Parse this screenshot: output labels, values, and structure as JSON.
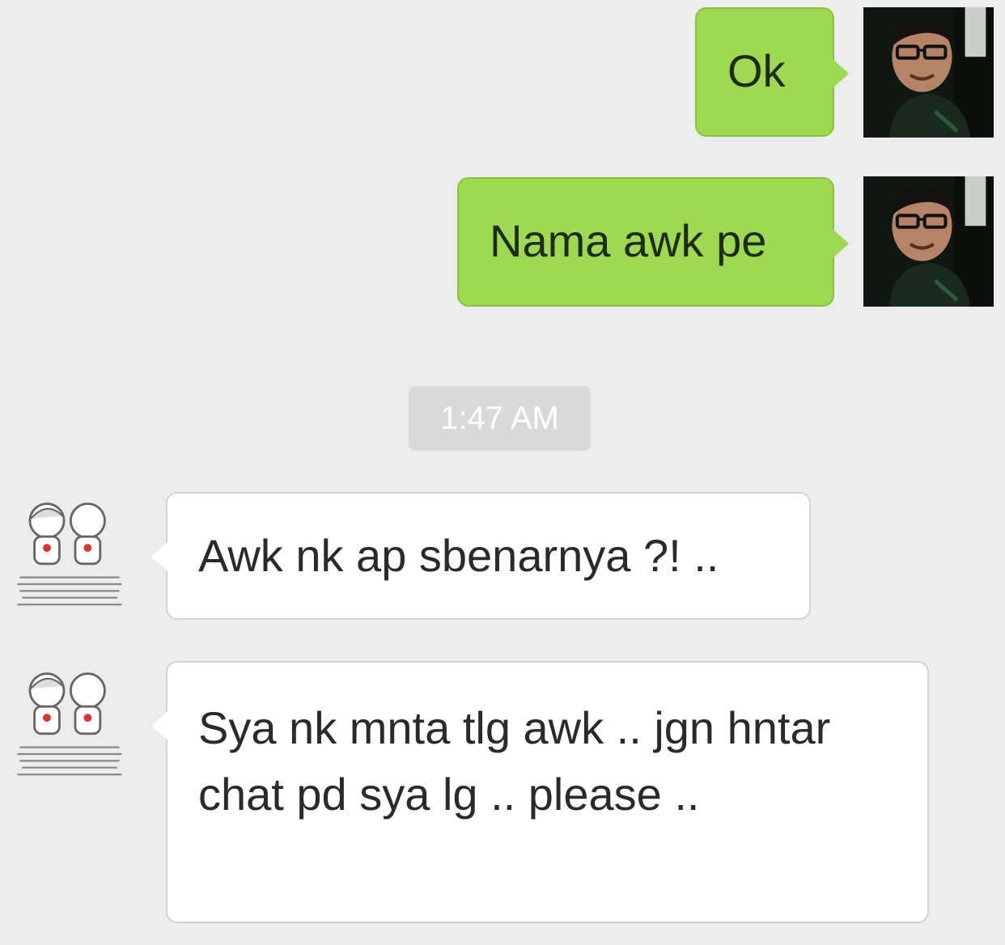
{
  "messages": [
    {
      "sender": "me",
      "text": "Ok"
    },
    {
      "sender": "me",
      "text": "Nama awk pe"
    },
    {
      "sender": "other",
      "text": "Awk nk ap sbenarnya ?! .."
    },
    {
      "sender": "other",
      "text": "Sya nk mnta tlg awk .. jgn hntar chat pd sya lg .. please .."
    }
  ],
  "timestamp": "1:47 AM",
  "colors": {
    "background": "#ececec",
    "outgoing_bubble": "#9ed952",
    "incoming_bubble": "#ffffff",
    "timestamp_bg": "#d9d9d9"
  },
  "icons": {
    "my_avatar": "user-photo-avatar",
    "other_avatar": "cartoon-couple-avatar"
  }
}
